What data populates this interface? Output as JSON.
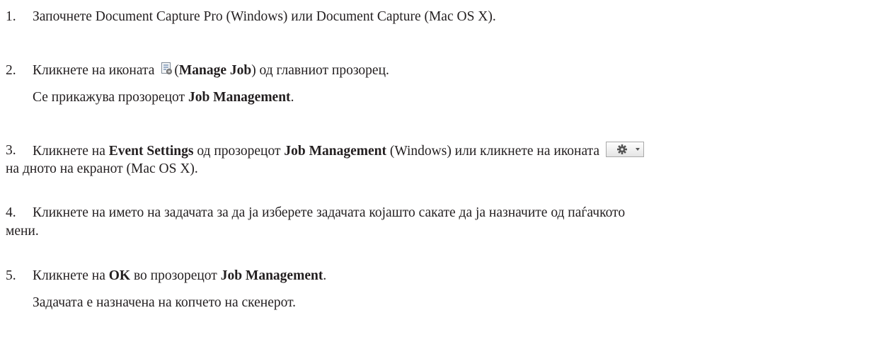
{
  "steps": [
    {
      "number": "1.",
      "text": "Започнете Document Capture Pro (Windows) или Document Capture (Mac OS X)."
    },
    {
      "number": "2.",
      "before_icon": "Кликнете на иконата",
      "icon": "manage-job-icon",
      "paren_open": "(",
      "bold": "Manage Job",
      "after": ") од главниот прозорец.",
      "result_before": "Се прикажува прозорецот ",
      "result_bold": "Job Management",
      "result_after": "."
    },
    {
      "number": "3.",
      "part1": "Кликнете на ",
      "bold1": "Event Settings",
      "part2": " од прозорецот ",
      "bold2": "Job Management",
      "part3": " (Windows) или кликнете на иконата",
      "icon": "gear-dropdown-icon",
      "line2": "на дното на екранот (Mac OS X)."
    },
    {
      "number": "4.",
      "line1": "Кликнете на името на задачата за да ја изберете задачата којашто сакате да ја назначите од паѓачкото",
      "line2": "мени."
    },
    {
      "number": "5.",
      "part1": "Кликнете на ",
      "bold1": "OK",
      "part2": " во прозорецот ",
      "bold2": "Job Management",
      "part3": ".",
      "result": "Задачата е назначена на копчето на скенерот."
    }
  ]
}
